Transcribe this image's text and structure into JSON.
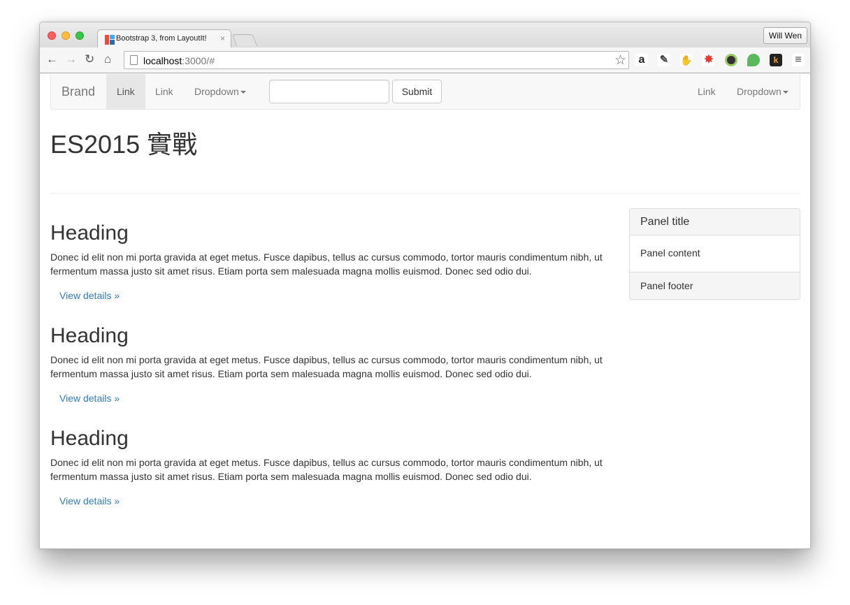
{
  "browser": {
    "tab_title": "Bootstrap 3, from LayoutIt!",
    "tab_close": "×",
    "profile_name": "Will Wen",
    "url_host": "localhost",
    "url_rest": ":3000/#"
  },
  "navbar": {
    "brand": "Brand",
    "left_links": [
      "Link",
      "Link"
    ],
    "dropdown_left": "Dropdown",
    "search_value": "",
    "submit_label": "Submit",
    "right_link": "Link",
    "dropdown_right": "Dropdown"
  },
  "page": {
    "title": "ES2015 實戰"
  },
  "sections": [
    {
      "heading": "Heading",
      "body": "Donec id elit non mi porta gravida at eget metus. Fusce dapibus, tellus ac cursus commodo, tortor mauris condimentum nibh, ut fermentum massa justo sit amet risus. Etiam porta sem malesuada magna mollis euismod. Donec sed odio dui.",
      "link": "View details »"
    },
    {
      "heading": "Heading",
      "body": "Donec id elit non mi porta gravida at eget metus. Fusce dapibus, tellus ac cursus commodo, tortor mauris condimentum nibh, ut fermentum massa justo sit amet risus. Etiam porta sem malesuada magna mollis euismod. Donec sed odio dui.",
      "link": "View details »"
    },
    {
      "heading": "Heading",
      "body": "Donec id elit non mi porta gravida at eget metus. Fusce dapibus, tellus ac cursus commodo, tortor mauris condimentum nibh, ut fermentum massa justo sit amet risus. Etiam porta sem malesuada magna mollis euismod. Donec sed odio dui.",
      "link": "View details »"
    }
  ],
  "panel": {
    "title": "Panel title",
    "content": "Panel content",
    "footer": "Panel footer"
  },
  "icons": [
    "back-arrow-icon",
    "forward-arrow-icon",
    "reload-icon",
    "home-icon",
    "page-icon",
    "bookmark-star-icon",
    "amazon-icon",
    "tool-icon",
    "evernote-icon",
    "badge-icon",
    "camera-icon",
    "chat-icon",
    "k-icon",
    "menu-icon"
  ],
  "colors": {
    "link": "#337ab7",
    "navbar_bg": "#f8f8f8",
    "text": "#333333"
  }
}
